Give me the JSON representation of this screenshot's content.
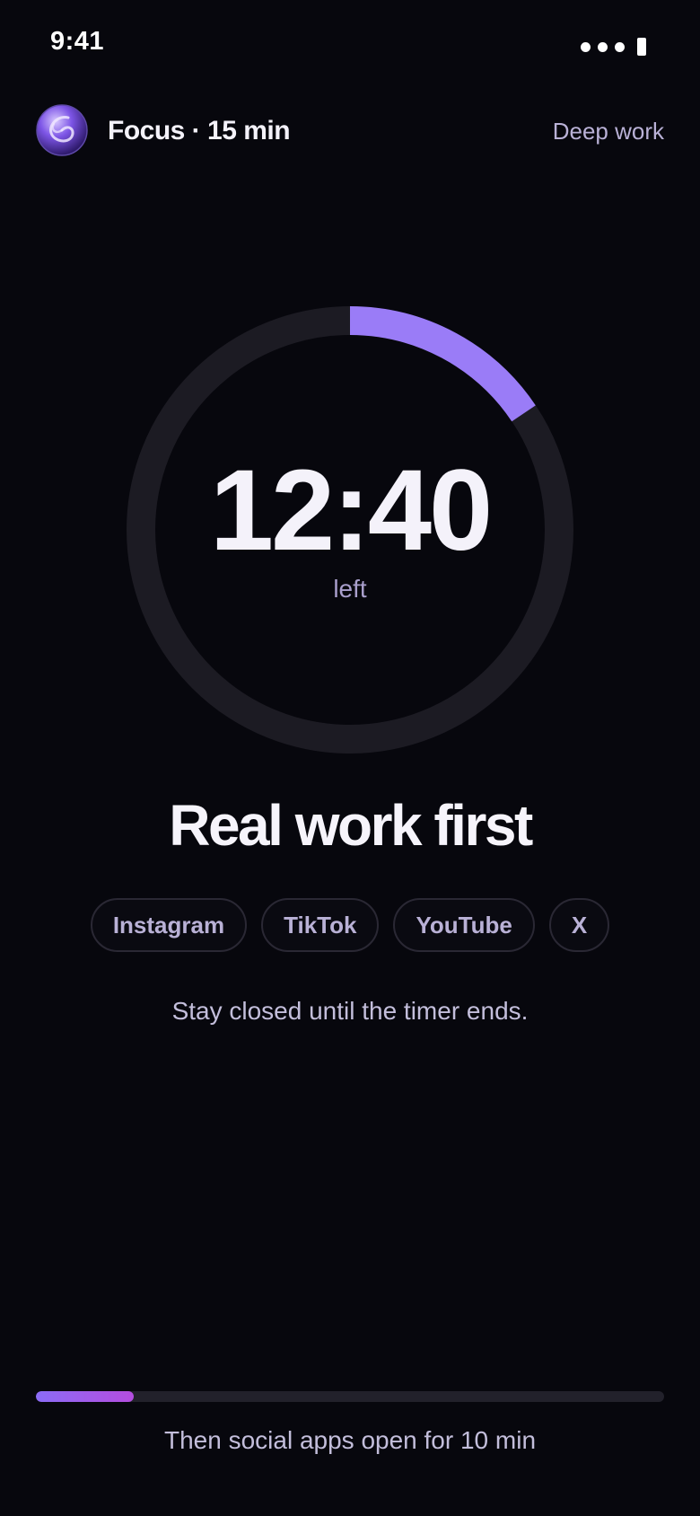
{
  "status_bar": {
    "time": "9:41",
    "icons": [
      "signal-dots-icon",
      "battery-icon"
    ]
  },
  "header": {
    "avatar_icon": "focus-orb-icon",
    "title": "Focus · 15 min",
    "mode_label": "Deep work"
  },
  "timer": {
    "value": "12:40",
    "caption": "left",
    "progress_fraction": 0.156,
    "accent_color": "#9a7cf7",
    "track_color": "#1c1b23"
  },
  "main": {
    "headline": "Real work first",
    "apps": [
      "Instagram",
      "TikTok",
      "YouTube",
      "X"
    ],
    "subtext": "Stay closed until the timer ends."
  },
  "footer": {
    "progress_percent": 15.6,
    "note": "Then social apps open for 10 min"
  },
  "colors": {
    "background": "#07070d",
    "accent": "#9a7cf7",
    "accent_end": "#b44ddf"
  }
}
